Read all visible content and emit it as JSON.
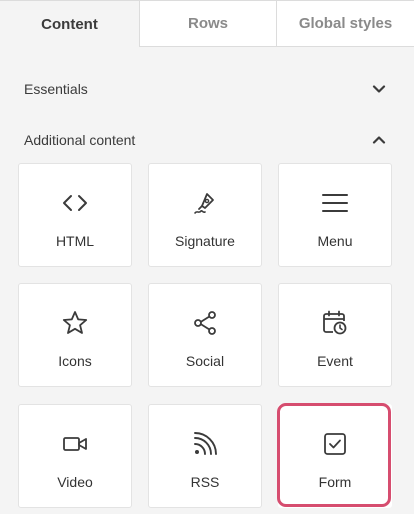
{
  "tabs": [
    {
      "label": "Content",
      "active": true
    },
    {
      "label": "Rows",
      "active": false
    },
    {
      "label": "Global styles",
      "active": false
    }
  ],
  "sections": {
    "essentials": {
      "label": "Essentials",
      "state": "collapsed",
      "icon": "chevron-down-icon"
    },
    "additional": {
      "label": "Additional content",
      "state": "expanded",
      "icon": "chevron-up-icon"
    }
  },
  "tiles": [
    {
      "label": "HTML",
      "icon": "code-icon"
    },
    {
      "label": "Signature",
      "icon": "pen-nib-icon"
    },
    {
      "label": "Menu",
      "icon": "hamburger-menu-icon"
    },
    {
      "label": "Icons",
      "icon": "star-icon"
    },
    {
      "label": "Social",
      "icon": "share-icon"
    },
    {
      "label": "Event",
      "icon": "calendar-clock-icon"
    },
    {
      "label": "Video",
      "icon": "video-camera-icon"
    },
    {
      "label": "RSS",
      "icon": "rss-icon"
    },
    {
      "label": "Form",
      "icon": "checkbox-icon",
      "highlighted": true
    }
  ],
  "colors": {
    "highlight": "#d64d6f",
    "panel_bg": "#f4f4f4",
    "tile_bg": "#ffffff",
    "icon": "#3b3b3b"
  }
}
